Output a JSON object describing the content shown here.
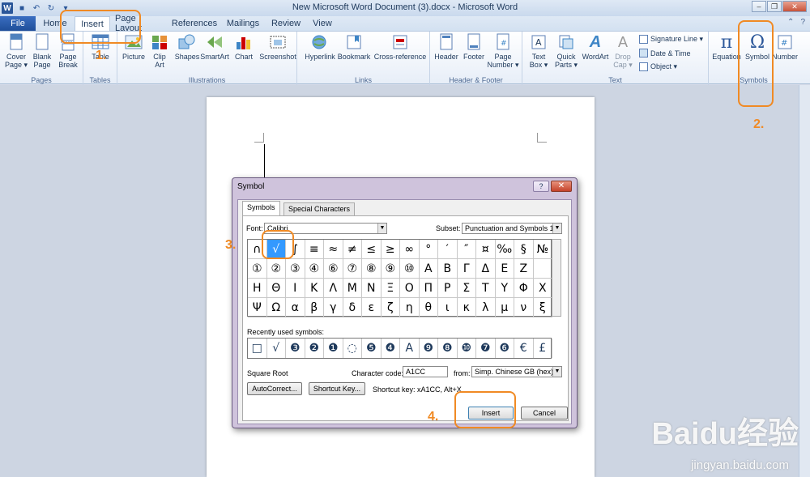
{
  "window": {
    "title": "New Microsoft Word Document (3).docx - Microsoft Word"
  },
  "tabs": [
    {
      "label": "File"
    },
    {
      "label": "Home"
    },
    {
      "label": "Insert"
    },
    {
      "label": "Page Layout"
    },
    {
      "label": "References"
    },
    {
      "label": "Mailings"
    },
    {
      "label": "Review"
    },
    {
      "label": "View"
    }
  ],
  "ribbon": {
    "pages": {
      "label": "Pages",
      "cover": "Cover\nPage ▾",
      "blank": "Blank\nPage",
      "break": "Page\nBreak"
    },
    "tables": {
      "label": "Tables",
      "table": "Table"
    },
    "illustrations": {
      "label": "Illustrations",
      "picture": "Picture",
      "clipart": "Clip\nArt",
      "shapes": "Shapes",
      "smartart": "SmartArt",
      "chart": "Chart",
      "screenshot": "Screenshot"
    },
    "links": {
      "label": "Links",
      "hyperlink": "Hyperlink",
      "bookmark": "Bookmark",
      "crossref": "Cross-reference"
    },
    "headerfooter": {
      "label": "Header & Footer",
      "header": "Header",
      "footer": "Footer",
      "pagenumber": "Page\nNumber ▾"
    },
    "text": {
      "label": "Text",
      "textbox": "Text\nBox ▾",
      "quickparts": "Quick\nParts ▾",
      "wordart": "WordArt",
      "dropcap": "Drop\nCap ▾",
      "sigline": "Signature Line ▾",
      "datetime": "Date & Time",
      "object": "Object ▾"
    },
    "symbols": {
      "label": "Symbols",
      "equation": "Equation",
      "symbol": "Symbol",
      "number": "Number"
    }
  },
  "dialog": {
    "title": "Symbol",
    "help": "?",
    "close": "✕",
    "tab_symbols": "Symbols",
    "tab_special": "Special Characters",
    "font_label": "Font:",
    "font_value": "Calibri",
    "subset_label": "Subset:",
    "subset_value": "Punctuation and Symbols 1",
    "grid": [
      "∩",
      "√",
      "∫",
      "≡",
      "≈",
      "≠",
      "≤",
      "≥",
      "∞",
      "°",
      "′",
      "″",
      "¤",
      "‰",
      "§",
      "№",
      "①",
      "②",
      "③",
      "④",
      "⑥",
      "⑦",
      "⑧",
      "⑨",
      "⑩",
      "Α",
      "Β",
      "Γ",
      "Δ",
      "Ε",
      "Ζ",
      "",
      "Η",
      "Θ",
      "Ι",
      "Κ",
      "Λ",
      "Μ",
      "Ν",
      "Ξ",
      "Ο",
      "Π",
      "Ρ",
      "Σ",
      "Τ",
      "Υ",
      "Φ",
      "Χ",
      "Ψ",
      "Ω",
      "α",
      "β",
      "γ",
      "δ",
      "ε",
      "ζ",
      "η",
      "θ",
      "ι",
      "κ",
      "λ",
      "μ",
      "ν",
      "ξ"
    ],
    "recent_label": "Recently used symbols:",
    "recent": [
      "□",
      "√",
      "❸",
      "❷",
      "❶",
      "◌",
      "❺",
      "❹",
      "Α",
      "❾",
      "❽",
      "❿",
      "❼",
      "❻",
      "€",
      "£"
    ],
    "char_name": "Square Root",
    "code_label": "Character code:",
    "code_value": "A1CC",
    "from_label": "from:",
    "from_value": "Simp. Chinese GB (hex)",
    "autocorrect": "AutoCorrect...",
    "shortcut_key": "Shortcut Key...",
    "shortcut_text": "Shortcut key: xA1CC, Alt+X",
    "insert": "Insert",
    "cancel": "Cancel"
  },
  "annotations": {
    "n1": "1.",
    "n2": "2.",
    "n3": "3.",
    "n4": "4."
  },
  "watermark": {
    "brand": "Baidu经验",
    "url": "jingyan.baidu.com"
  },
  "colors": {
    "annotation": "#f08a24",
    "file_tab": "#2a5699",
    "selected_symbol": "#3399ff"
  }
}
